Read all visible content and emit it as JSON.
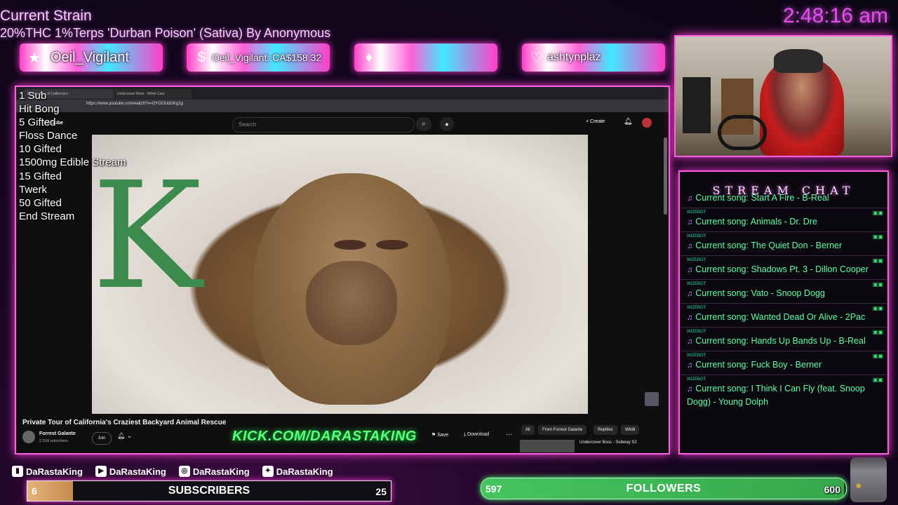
{
  "overlay": {
    "strain_title": "Current Strain",
    "strain_desc": "20%THC 1%Terps 'Durban Poison' (Sativa) By Anonymous",
    "clock": "2:48:16 am"
  },
  "alerts": [
    {
      "icon": "star-icon",
      "text": "Oeil_Vigilant"
    },
    {
      "icon": "dollar-icon",
      "text": "Oeil_Vigilant: CA$158.32"
    },
    {
      "icon": "diamond-icon",
      "text": ""
    },
    {
      "icon": "heart-icon",
      "text": "ashtynplaz"
    }
  ],
  "goals": [
    "1 Sub",
    "Hit Bong",
    "5 Gifted",
    "Floss Dance",
    "10 Gifted",
    "1500mg Edible Stream",
    "15 Gifted",
    "Twerk",
    "50 Gifted",
    "End Stream"
  ],
  "kick_url": "KICK.COM/DARASTAKING",
  "browser": {
    "tab_active": "Private Tour of California's",
    "tab_2": "Undercover Boss - White Cast",
    "url": "https://www.youtube.com/watch?v=OYOOUdUKg1g",
    "yt_logo": "YouTube",
    "search_placeholder": "Search",
    "create_label": "Create",
    "video_title": "Private Tour of California's Craziest Backyard Animal Rescue",
    "channel_name": "Forrest Galante",
    "channel_subs": "2.31M subscribers",
    "join_label": "Join",
    "save_label": "Save",
    "download_label": "Download",
    "chips": [
      "All",
      "From Forrest Galante",
      "Reptiles",
      "Wildli"
    ],
    "rec_title": "Undercover Boss - Subway S2"
  },
  "chat": {
    "title": "STREAM CHAT",
    "messages": [
      {
        "user": "",
        "text": "Current song: Start A Fire - B-Real"
      },
      {
        "user": "WIZEBOT",
        "text": "Current song: Animals - Dr. Dre"
      },
      {
        "user": "WIZEBOT",
        "text": "Current song: The Quiet Don - Berner"
      },
      {
        "user": "WIZEBOT",
        "text": "Current song: Shadows Pt. 3 - Dillon Cooper"
      },
      {
        "user": "WIZEBOT",
        "text": "Current song: Vato - Snoop Dogg"
      },
      {
        "user": "WIZEBOT",
        "text": "Current song: Wanted Dead Or Alive - 2Pac"
      },
      {
        "user": "WIZEBOT",
        "text": "Current song: Hands Up Bands Up - B-Real"
      },
      {
        "user": "WIZEBOT",
        "text": "Current song: Fuck Boy - Berner"
      },
      {
        "user": "WIZEBOT",
        "text": "Current song: I Think I Can Fly (feat. Snoop Dogg) - Young Dolph"
      }
    ]
  },
  "socials": [
    {
      "icon": "twitch-icon",
      "name": "DaRastaKing"
    },
    {
      "icon": "youtube-icon",
      "name": "DaRastaKing"
    },
    {
      "icon": "instagram-icon",
      "name": "DaRastaKing"
    },
    {
      "icon": "twitter-icon",
      "name": "DaRastaKing"
    }
  ],
  "subscribers": {
    "label": "SUBSCRIBERS",
    "current": 6,
    "goal": 25,
    "progress": 0.24
  },
  "followers": {
    "label": "FOLLOWERS",
    "current": 597,
    "goal": 600,
    "progress": 0.995
  },
  "colors": {
    "accent_pink": "#ff5fe0",
    "chat_green": "#5effa5",
    "kick_green": "#57ff7c",
    "clock_purple": "#e44ef0"
  }
}
